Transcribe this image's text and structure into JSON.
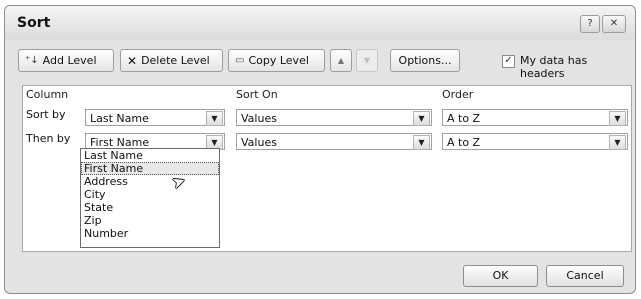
{
  "window": {
    "title": "Sort",
    "help_btn": "?",
    "close_btn": "✕"
  },
  "toolbar": {
    "add_level": "Add Level",
    "delete_level": "Delete Level",
    "copy_level": "Copy Level",
    "up_arrow": "▲",
    "down_arrow": "▼",
    "options": "Options...",
    "headers_checkbox": "✓",
    "headers_label": "My data has headers"
  },
  "grid": {
    "headers": {
      "column": "Column",
      "sort_on": "Sort On",
      "order": "Order"
    },
    "rows": [
      {
        "label": "Sort by",
        "column": "Last Name",
        "sort_on": "Values",
        "order": "A to Z"
      },
      {
        "label": "Then by",
        "column": "First Name",
        "sort_on": "Values",
        "order": "A to Z"
      }
    ],
    "dropdown_items": [
      "Last Name",
      "First Name",
      "Address",
      "City",
      "State",
      "Zip",
      "Number"
    ],
    "dropdown_selected_index": 1
  },
  "footer": {
    "ok": "OK",
    "cancel": "Cancel"
  },
  "icons": {
    "dropdown_arrow": "▼",
    "cursor": "➤"
  }
}
